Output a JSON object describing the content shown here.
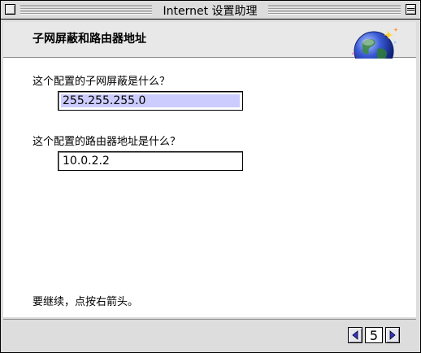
{
  "window": {
    "title": "Internet 设置助理"
  },
  "header": {
    "title": "子网屏蔽和路由器地址",
    "icon": "globe-icon"
  },
  "form": {
    "subnet_question": "这个配置的子网屏蔽是什么？",
    "subnet_value": "255.255.255.0",
    "router_question": "这个配置的路由器地址是什么？",
    "router_value": "10.0.2.2"
  },
  "footer": {
    "hint": "要继续，点按右箭头。"
  },
  "nav": {
    "page": "5",
    "prev_icon": "left-arrow-icon",
    "next_icon": "right-arrow-icon"
  },
  "colors": {
    "selection": "#ccccff",
    "arrow": "#3333cc"
  }
}
